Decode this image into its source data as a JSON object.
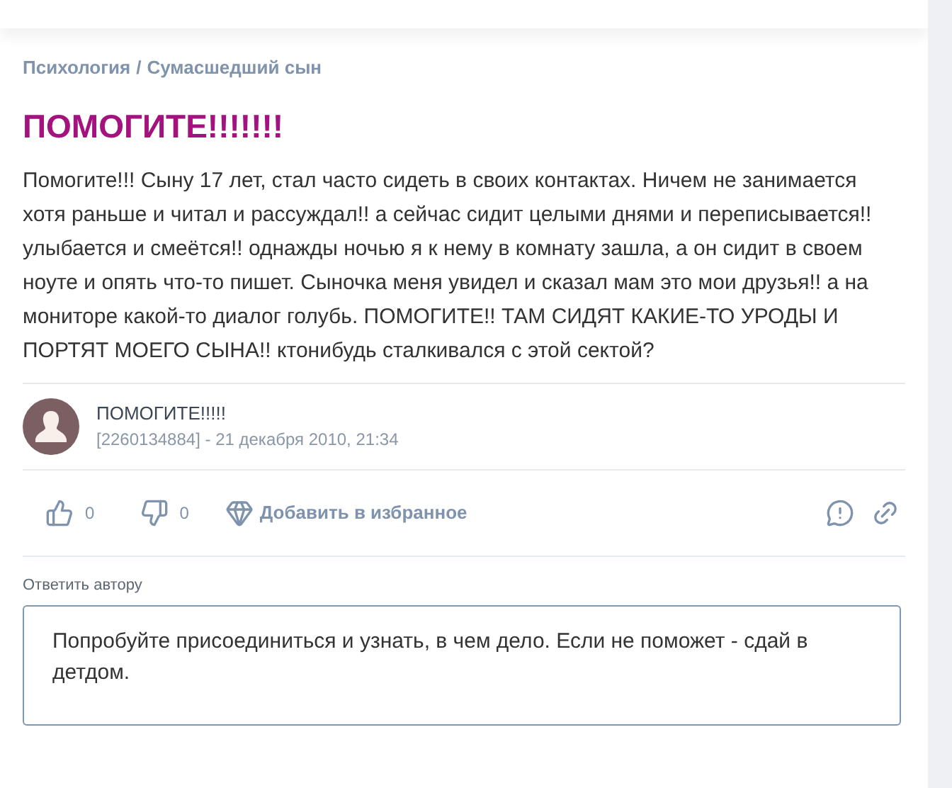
{
  "breadcrumb": {
    "section": "Психология",
    "separator": "/",
    "topic": "Сумасшедший сын"
  },
  "title": "ПОМОГИТЕ!!!!!!!",
  "body": "Помогите!!! Сыну 17 лет, стал часто сидеть в своих контактах. Ничем не занимается хотя раньше и читал и рассуждал!! а сейчас сидит целыми днями и переписывается!! улыбается и смеётся!! однажды ночью я к нему в комнату зашла, а он сидит в своем ноуте и опять что-то пишет. Сыночка меня увидел и сказал мам это мои друзья!! а на мониторе какой-то диалог голубь. ПОМОГИТЕ!! ТАМ СИДЯТ КАКИЕ-ТО УРОДЫ И ПОРТЯТ МОЕГО СЫНА!! ктонибудь сталкивался с этой сектой?",
  "author": {
    "name": "ПОМОГИТЕ!!!!!",
    "meta": "[2260134884] - 21 декабря 2010, 21:34"
  },
  "actions": {
    "likes": "0",
    "dislikes": "0",
    "favorite": "Добавить в избранное"
  },
  "reply": {
    "label": "Ответить автору",
    "value": "Попробуйте присоединиться и узнать, в чем дело. Если не поможет - сдай в детдом."
  }
}
